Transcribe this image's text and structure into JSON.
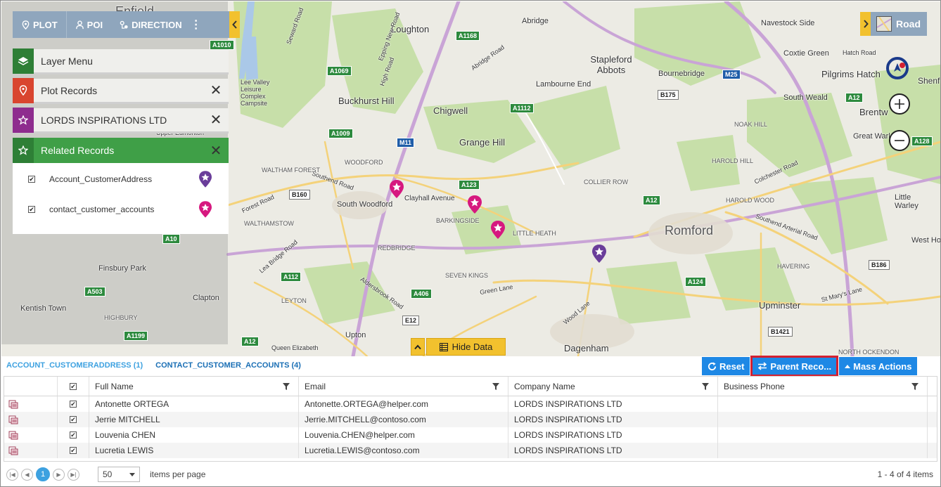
{
  "toolbar": {
    "plot_label": "PLOT",
    "poi_label": "POI",
    "direction_label": "DIRECTION",
    "more_label": "⋮"
  },
  "panels": {
    "layer_menu": "Layer Menu",
    "plot_records": "Plot Records",
    "lords": "LORDS INSPIRATIONS LTD",
    "related_records": "Related Records",
    "close_glyph": "✕"
  },
  "related_items": [
    {
      "label": "Account_CustomerAddress",
      "checked": true,
      "pin_color": "#6a3d9a"
    },
    {
      "label": "contact_customer_accounts",
      "checked": true,
      "pin_color": "#d6187f"
    }
  ],
  "map": {
    "style_label": "Road",
    "hide_data_label": "Hide Data",
    "places": [
      {
        "text": "Enfield"
      },
      {
        "text": "Loughton"
      },
      {
        "text": "Abridge"
      },
      {
        "text": "Navestock Side"
      },
      {
        "text": "Coxtie Green"
      },
      {
        "text": "Hatch Road"
      },
      {
        "text": "Stapleford Abbots"
      },
      {
        "text": "Bournebridge"
      },
      {
        "text": "Pilgrims Hatch"
      },
      {
        "text": "Lambourne End"
      },
      {
        "text": "Buckhurst Hill"
      },
      {
        "text": "Chigwell"
      },
      {
        "text": "South Weald"
      },
      {
        "text": "Brentw"
      },
      {
        "text": "Grange Hill"
      },
      {
        "text": "Great Warl"
      },
      {
        "text": "Clayhall Avenue"
      },
      {
        "text": "South Woodford"
      },
      {
        "text": "Romford"
      },
      {
        "text": "Little Warley"
      },
      {
        "text": "Finsbury Park"
      },
      {
        "text": "Clapton"
      },
      {
        "text": "Kentish Town"
      },
      {
        "text": "Upminster"
      },
      {
        "text": "Dagenham"
      },
      {
        "text": "Upton"
      },
      {
        "text": "Lee Valley Leisure Complex Campsite"
      },
      {
        "text": "Upper Edmonton"
      },
      {
        "text": "West Ho"
      },
      {
        "text": "Forest Road"
      },
      {
        "text": "Southend Road"
      },
      {
        "text": "Green Lane"
      },
      {
        "text": "Wood Lane"
      },
      {
        "text": "Colchester Road"
      },
      {
        "text": "Southend Arterial Road"
      },
      {
        "text": "Lea Bridge Road"
      },
      {
        "text": "Aldersbrook Road"
      },
      {
        "text": "St Mary's Lane"
      },
      {
        "text": "Queen Elizabeth"
      },
      {
        "text": "Shenf"
      },
      {
        "text": "Epping New Road"
      },
      {
        "text": "High Road"
      },
      {
        "text": "Abridge Road"
      },
      {
        "text": "Seward Road"
      }
    ],
    "small_places": [
      {
        "text": "WALTHAM FOREST"
      },
      {
        "text": "WOODFORD"
      },
      {
        "text": "WALTHAMSTOW"
      },
      {
        "text": "REDBRIDGE"
      },
      {
        "text": "BARKINGSIDE"
      },
      {
        "text": "SEVEN KINGS"
      },
      {
        "text": "LITTLE HEATH"
      },
      {
        "text": "COLLIER ROW"
      },
      {
        "text": "HAVERING"
      },
      {
        "text": "HAROLD HILL"
      },
      {
        "text": "HAROLD WOOD"
      },
      {
        "text": "NOAK HILL"
      },
      {
        "text": "LEYTON"
      },
      {
        "text": "HIGHBURY"
      },
      {
        "text": "NORTH OCKENDON"
      }
    ],
    "road_badges": [
      {
        "text": "A1010",
        "kind": "green"
      },
      {
        "text": "A1168",
        "kind": "green"
      },
      {
        "text": "A1069",
        "kind": "green"
      },
      {
        "text": "A1112",
        "kind": "green"
      },
      {
        "text": "M25",
        "kind": "blue"
      },
      {
        "text": "B175",
        "kind": "white"
      },
      {
        "text": "A12",
        "kind": "green"
      },
      {
        "text": "A1009",
        "kind": "green"
      },
      {
        "text": "M11",
        "kind": "blue"
      },
      {
        "text": "A123",
        "kind": "green"
      },
      {
        "text": "B160",
        "kind": "white"
      },
      {
        "text": "A12",
        "kind": "green"
      },
      {
        "text": "A10",
        "kind": "green"
      },
      {
        "text": "A112",
        "kind": "green"
      },
      {
        "text": "A503",
        "kind": "green"
      },
      {
        "text": "A406",
        "kind": "green"
      },
      {
        "text": "A124",
        "kind": "green"
      },
      {
        "text": "B186",
        "kind": "white"
      },
      {
        "text": "A1199",
        "kind": "green"
      },
      {
        "text": "A12",
        "kind": "green"
      },
      {
        "text": "B1421",
        "kind": "white"
      },
      {
        "text": "A128",
        "kind": "green"
      },
      {
        "text": "E12",
        "kind": "white"
      }
    ],
    "markers": [
      {
        "color": "#d6187f"
      },
      {
        "color": "#d6187f"
      },
      {
        "color": "#d6187f"
      },
      {
        "color": "#6a3d9a"
      }
    ]
  },
  "tabs": [
    {
      "label": "ACCOUNT_CUSTOMERADDRESS (1)",
      "active": false
    },
    {
      "label": "CONTACT_CUSTOMER_ACCOUNTS (4)",
      "active": true
    }
  ],
  "actions": {
    "reset_label": "Reset",
    "parent_label": "Parent Reco...",
    "mass_label": "Mass Actions"
  },
  "grid": {
    "columns": [
      "Full Name",
      "Email",
      "Company Name",
      "Business Phone"
    ],
    "rows": [
      {
        "name": "Antonette ORTEGA",
        "email": "Antonette.ORTEGA@helper.com",
        "company": "LORDS INSPIRATIONS LTD",
        "phone": ""
      },
      {
        "name": "Jerrie MITCHELL",
        "email": "Jerrie.MITCHELL@contoso.com",
        "company": "LORDS INSPIRATIONS LTD",
        "phone": ""
      },
      {
        "name": "Louvenia CHEN",
        "email": "Louvenia.CHEN@helper.com",
        "company": "LORDS INSPIRATIONS LTD",
        "phone": ""
      },
      {
        "name": "Lucretia LEWIS",
        "email": "Lucretia.LEWIS@contoso.com",
        "company": "LORDS INSPIRATIONS LTD",
        "phone": ""
      }
    ]
  },
  "pager": {
    "current_page": "1",
    "page_size": "50",
    "per_page_label": "items per page",
    "range_label": "1 - 4 of 4 items"
  },
  "colors": {
    "accent_blue": "#1e88e5",
    "yellow": "#f2c12e",
    "highlight_red": "#d32030",
    "green": "#3f9f47"
  }
}
